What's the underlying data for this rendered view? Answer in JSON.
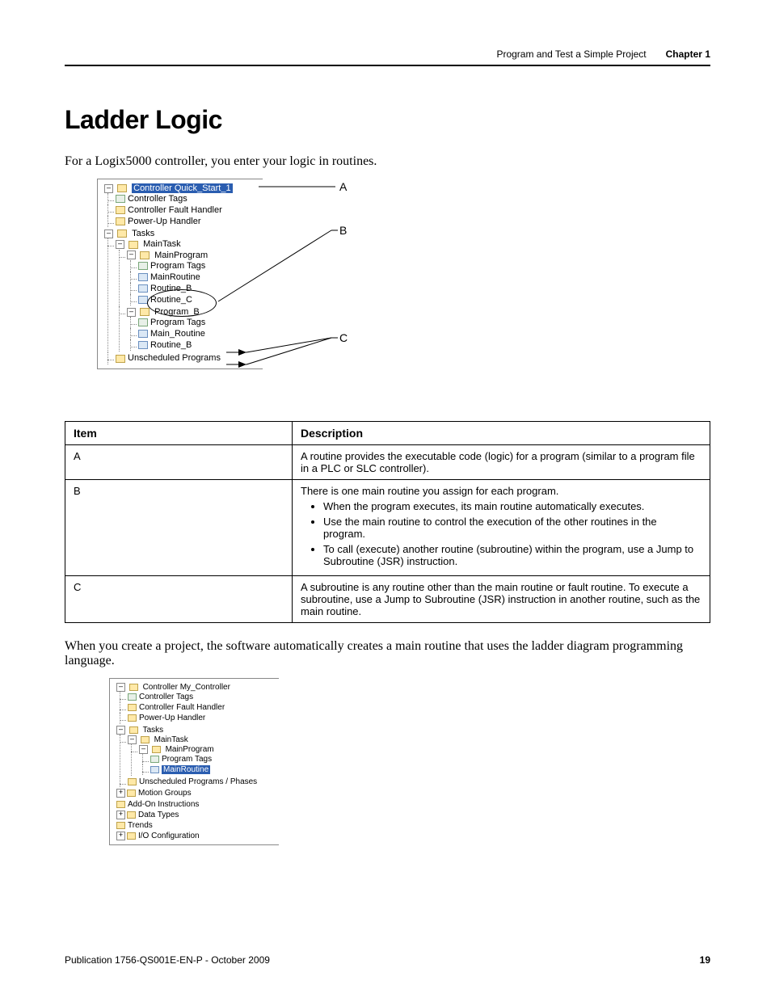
{
  "header": {
    "breadcrumb": "Program and Test a Simple Project",
    "chapter_label": "Chapter 1"
  },
  "section": {
    "title": "Ladder Logic",
    "intro": "For a Logix5000 controller, you enter your logic in routines.",
    "body2": "When you create a project, the software automatically creates a main routine that uses the ladder diagram programming language."
  },
  "figure1": {
    "callouts": {
      "a": "A",
      "b": "B",
      "c": "C"
    },
    "tree": {
      "root": "Controller Quick_Start_1",
      "controller_tags": "Controller Tags",
      "fault_handler": "Controller Fault Handler",
      "powerup": "Power-Up Handler",
      "tasks": "Tasks",
      "maintask": "MainTask",
      "mainprogram": "MainProgram",
      "program_tags": "Program Tags",
      "mainroutine": "MainRoutine",
      "routine_b": "Routine_B",
      "routine_c": "Routine_C",
      "program_b": "Program_B",
      "program_tags2": "Program Tags",
      "main_routine2": "Main_Routine",
      "routine_b2": "Routine_B",
      "unscheduled": "Unscheduled Programs"
    }
  },
  "table": {
    "headers": {
      "item": "Item",
      "desc": "Description"
    },
    "rows": {
      "a": {
        "item": "A",
        "desc": "A routine provides the executable code (logic) for a program (similar to a program file in a PLC or SLC controller)."
      },
      "b": {
        "item": "B",
        "intro": "There is one main routine you assign for each program.",
        "b1": "When the program executes, its main routine automatically executes.",
        "b2": "Use the main routine to control the execution of the other routines in the program.",
        "b3": "To call (execute) another routine (subroutine) within the program, use a Jump to Subroutine (JSR) instruction."
      },
      "c": {
        "item": "C",
        "desc": "A subroutine is any routine other than the main routine or fault routine. To execute a subroutine, use a Jump to Subroutine (JSR) instruction in another routine, such as the main routine."
      }
    }
  },
  "figure2": {
    "tree": {
      "root": "Controller My_Controller",
      "controller_tags": "Controller Tags",
      "fault_handler": "Controller Fault Handler",
      "powerup": "Power-Up Handler",
      "tasks": "Tasks",
      "maintask": "MainTask",
      "mainprogram": "MainProgram",
      "program_tags": "Program Tags",
      "mainroutine": "MainRoutine",
      "unscheduled": "Unscheduled Programs / Phases",
      "motion": "Motion Groups",
      "addon": "Add-On Instructions",
      "datatypes": "Data Types",
      "trends": "Trends",
      "io": "I/O Configuration"
    }
  },
  "footer": {
    "pub": "Publication 1756-QS001E-EN-P - October 2009",
    "page": "19"
  }
}
